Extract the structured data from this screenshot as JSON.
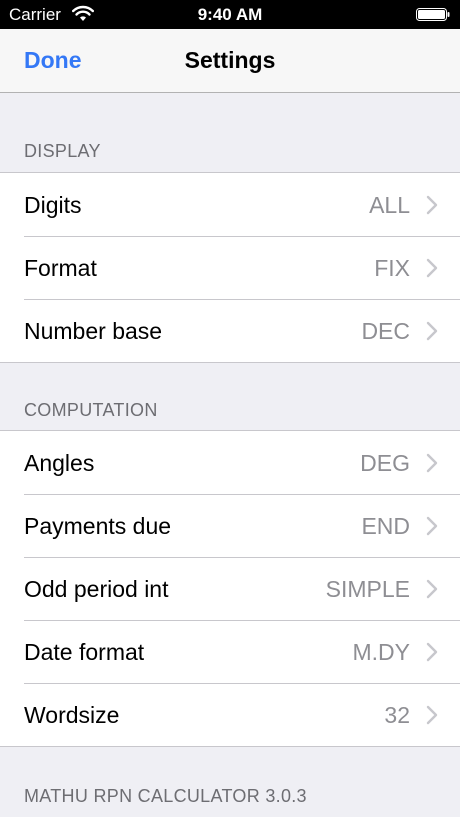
{
  "status_bar": {
    "carrier": "Carrier",
    "time": "9:40 AM"
  },
  "nav": {
    "done_label": "Done",
    "title": "Settings"
  },
  "sections": [
    {
      "header": "DISPLAY",
      "rows": [
        {
          "label": "Digits",
          "value": "ALL"
        },
        {
          "label": "Format",
          "value": "FIX"
        },
        {
          "label": "Number base",
          "value": "DEC"
        }
      ]
    },
    {
      "header": "COMPUTATION",
      "rows": [
        {
          "label": "Angles",
          "value": "DEG"
        },
        {
          "label": "Payments due",
          "value": "END"
        },
        {
          "label": "Odd period int",
          "value": "SIMPLE"
        },
        {
          "label": "Date format",
          "value": "M.DY"
        },
        {
          "label": "Wordsize",
          "value": "32"
        }
      ]
    }
  ],
  "footer": "MATHU RPN CALCULATOR 3.0.3",
  "colors": {
    "accent": "#3478f6",
    "secondary_text": "#8e8e93",
    "header_text": "#6d6d72",
    "background": "#efeff4"
  }
}
